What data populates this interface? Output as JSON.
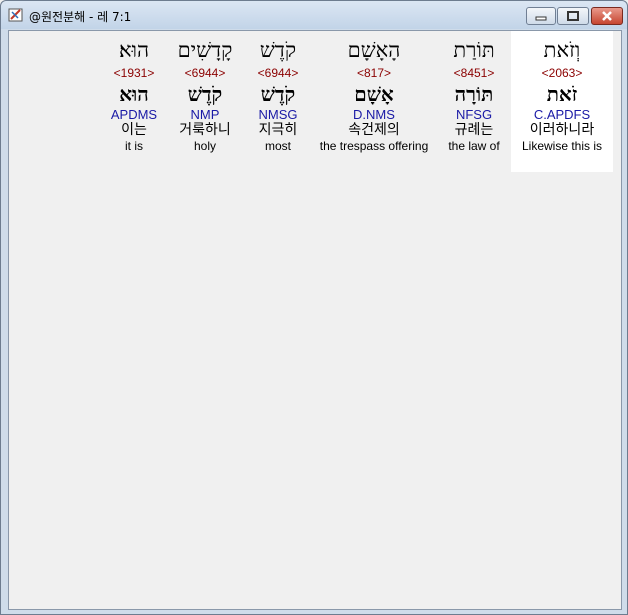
{
  "window": {
    "title": "@원전분해 - 레 7:1"
  },
  "words": [
    {
      "hebrew": "וְזֹאת",
      "strong": "<2063>",
      "lexeme": "זֹאת",
      "morph": "C.APDFS",
      "korean": "이러하니라",
      "english": "Likewise this is",
      "highlighted": true
    },
    {
      "hebrew": "תּוֹרַת",
      "strong": "<8451>",
      "lexeme": "תּוֹרָה",
      "morph": "NFSG",
      "korean": "규례는",
      "english": "the law of",
      "highlighted": false
    },
    {
      "hebrew": "הָאָשָׁם",
      "strong": "<817>",
      "lexeme": "אָשָׁם",
      "morph": "D.NMS",
      "korean": "속건제의",
      "english": "the trespass offering",
      "highlighted": false
    },
    {
      "hebrew": "קֹדֶשׁ",
      "strong": "<6944>",
      "lexeme": "קֹדֶשׁ",
      "morph": "NMSG",
      "korean": "지극히",
      "english": "most",
      "highlighted": false
    },
    {
      "hebrew": "קָדָשִׁים",
      "strong": "<6944>",
      "lexeme": "קֹדֶשׁ",
      "morph": "NMP",
      "korean": "거룩하니",
      "english": "holy",
      "highlighted": false
    },
    {
      "hebrew": "הוּא׃",
      "strong": "<1931>",
      "lexeme": "הוּא",
      "morph": "APDMS",
      "korean": "이는",
      "english": "it is",
      "highlighted": false
    }
  ]
}
